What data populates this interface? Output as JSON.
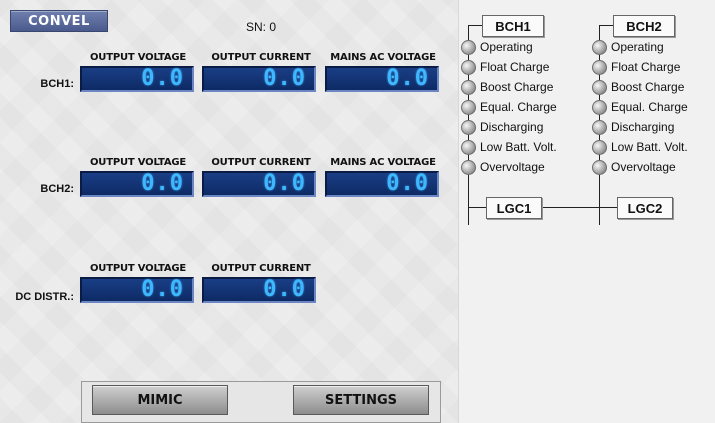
{
  "header": {
    "logo": "CONVEL",
    "sn": "SN: 0"
  },
  "columns": {
    "output_voltage": "OUTPUT VOLTAGE",
    "output_current": "OUTPUT CURRENT",
    "mains_ac_voltage": "MAINS AC VOLTAGE"
  },
  "rows": {
    "bch1": {
      "label": "BCH1:",
      "output_voltage": "0.0",
      "output_current": "0.0",
      "mains_ac_voltage": "0.0"
    },
    "bch2": {
      "label": "BCH2:",
      "output_voltage": "0.0",
      "output_current": "0.0",
      "mains_ac_voltage": "0.0"
    },
    "dc": {
      "label": "DC DISTR.:",
      "output_voltage": "0.0",
      "output_current": "0.0"
    }
  },
  "status": {
    "bch1_title": "BCH1",
    "bch2_title": "BCH2",
    "indicators": [
      "Operating",
      "Float Charge",
      "Boost Charge",
      "Equal. Charge",
      "Discharging",
      "Low Batt. Volt.",
      "Overvoltage"
    ],
    "lgc1": "LGC1",
    "lgc2": "LGC2"
  },
  "buttons": {
    "mimic": "MIMIC",
    "settings": "SETTINGS"
  }
}
